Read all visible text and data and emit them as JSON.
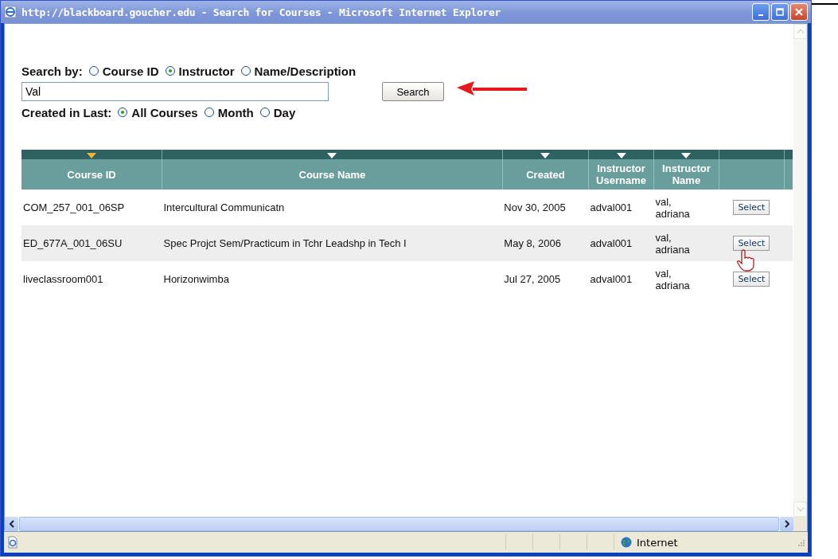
{
  "window": {
    "title": "http://blackboard.goucher.edu - Search for Courses - Microsoft Internet Explorer"
  },
  "search_by": {
    "label": "Search by:",
    "options": [
      {
        "label": "Course ID",
        "selected": false
      },
      {
        "label": "Instructor",
        "selected": true
      },
      {
        "label": "Name/Description",
        "selected": false
      }
    ]
  },
  "query": {
    "value": "Val"
  },
  "search_button": "Search",
  "created_in_last": {
    "label": "Created in Last:",
    "options": [
      {
        "label": "All Courses",
        "selected": true
      },
      {
        "label": "Month",
        "selected": false
      },
      {
        "label": "Day",
        "selected": false
      }
    ]
  },
  "table": {
    "columns": [
      {
        "label": "Course ID",
        "sorted": true
      },
      {
        "label": "Course Name",
        "sorted": false
      },
      {
        "label": "Created",
        "sorted": false
      },
      {
        "label": "Instructor Username",
        "sorted": false
      },
      {
        "label": "Instructor Name",
        "sorted": false
      }
    ],
    "rows": [
      {
        "cells": [
          "COM_257_001_06SP",
          "Intercultural Communicatn",
          "Nov 30, 2005",
          "adval001",
          "val, adriana"
        ],
        "action": "Select"
      },
      {
        "cells": [
          "ED_677A_001_06SU",
          "Spec Projct Sem/Practicum in Tchr Leadshp in Tech I",
          "May 8, 2006",
          "adval001",
          "val, adriana"
        ],
        "action": "Select"
      },
      {
        "cells": [
          "liveclassroom001",
          "Horizonwimba",
          "Jul 27, 2005",
          "adval001",
          "val, adriana"
        ],
        "action": "Select"
      }
    ]
  },
  "status_bar": {
    "zone": "Internet"
  }
}
